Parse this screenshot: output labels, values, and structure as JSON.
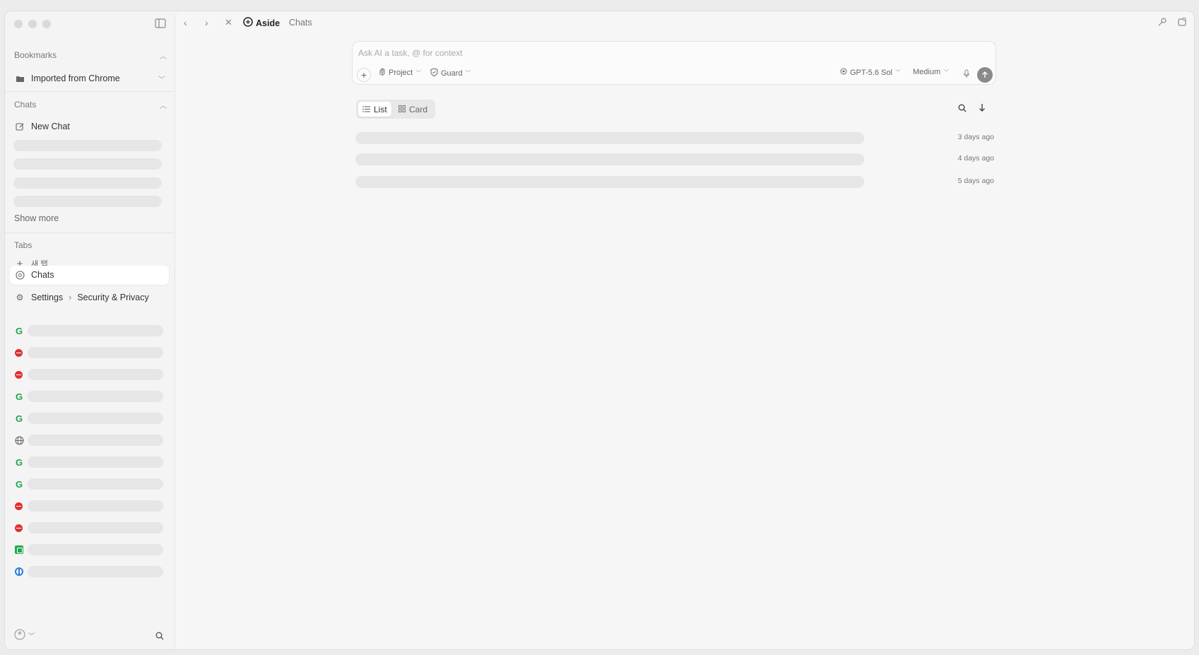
{
  "sidebar": {
    "bookmarks_label": "Bookmarks",
    "bookmark_folder": "Imported from Chrome",
    "chats_label": "Chats",
    "new_chat": "New Chat",
    "show_more": "Show more",
    "tabs_label": "Tabs",
    "new_tab": "새 탭",
    "active_tab": "Chats",
    "settings_tab": "Settings",
    "settings_sub": "Security & Privacy",
    "tab_favicons": [
      "g-icon",
      "red-icon",
      "red-icon",
      "g-icon",
      "g-icon",
      "globe-icon",
      "g-icon",
      "g-icon",
      "red-icon",
      "red-icon",
      "green-square-icon",
      "blue-icon"
    ]
  },
  "topbar": {
    "brand": "Aside",
    "crumb": "Chats"
  },
  "composer": {
    "placeholder": "Ask AI a task, @ for context",
    "project": "Project",
    "guard": "Guard",
    "model": "GPT-5.6 Sol",
    "effort": "Medium"
  },
  "view": {
    "list": "List",
    "card": "Card"
  },
  "chats": [
    {
      "time": "3 days ago"
    },
    {
      "time": "4 days ago"
    },
    {
      "time": "5 days ago"
    }
  ],
  "colors": {
    "google_green": "#22a447",
    "red_icon": "#e03131",
    "blue_icon": "#2f7de1"
  }
}
